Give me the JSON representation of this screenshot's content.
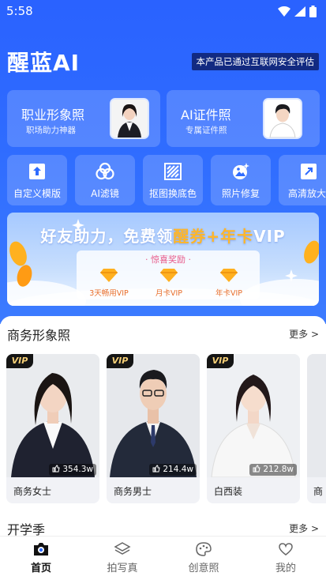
{
  "status": {
    "time": "5:58"
  },
  "header": {
    "logo": "醒蓝AI",
    "security_note": "本产品已通过互联网安全评估"
  },
  "feature_cards": [
    {
      "title": "职业形象照",
      "subtitle": "职场助力神器"
    },
    {
      "title": "AI证件照",
      "subtitle": "专属证件照"
    }
  ],
  "tools": [
    {
      "label": "自定义模版",
      "icon": "upload-icon"
    },
    {
      "label": "AI滤镜",
      "icon": "filter-circles-icon"
    },
    {
      "label": "抠图换底色",
      "icon": "cutout-icon"
    },
    {
      "label": "照片修复",
      "icon": "photo-repair-icon"
    },
    {
      "label": "高清放大",
      "icon": "enlarge-icon"
    }
  ],
  "banner": {
    "title_prefix": "好友助力，免费领",
    "title_highlight": "醒券+年卡",
    "title_suffix": "VIP",
    "reward_heading": "· 惊喜奖励 ·",
    "rewards": [
      "3天畅用VIP",
      "月卡VIP",
      "年卡VIP"
    ]
  },
  "business_section": {
    "title": "商务形象照",
    "more": "更多 >",
    "items": [
      {
        "vip": "VIP",
        "count": "354.3w",
        "name": "商务女士"
      },
      {
        "vip": "VIP",
        "count": "214.4w",
        "name": "商务男士"
      },
      {
        "vip": "VIP",
        "count": "212.8w",
        "name": "白西装"
      },
      {
        "name": "商"
      }
    ]
  },
  "school_section": {
    "title": "开学季",
    "more": "更多 >"
  },
  "tabbar": [
    {
      "label": "首页",
      "icon": "camera-home-icon",
      "active": true
    },
    {
      "label": "拍写真",
      "icon": "layers-icon",
      "active": false
    },
    {
      "label": "创意照",
      "icon": "palette-icon",
      "active": false
    },
    {
      "label": "我的",
      "icon": "heart-icon",
      "active": false
    }
  ],
  "colors": {
    "primary": "#2f6cff",
    "highlight": "#ffb629",
    "vip_gold": "#f6cf76"
  }
}
